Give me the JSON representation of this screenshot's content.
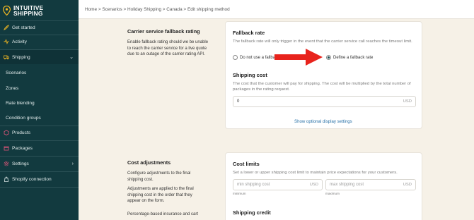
{
  "brand": {
    "line1": "INTUITIVE",
    "line2": "SHIPPING",
    "accent": "#f2b822",
    "sidebar_bg": "#123a3f"
  },
  "sidebar": {
    "items": [
      {
        "label": "Get started",
        "icon": "rocket-icon"
      },
      {
        "label": "Activity",
        "icon": "activity-icon"
      },
      {
        "label": "Shipping",
        "icon": "truck-icon"
      },
      {
        "label": "Scenarios"
      },
      {
        "label": "Zones"
      },
      {
        "label": "Rate blending"
      },
      {
        "label": "Condition groups"
      },
      {
        "label": "Products",
        "icon": "box-icon"
      },
      {
        "label": "Packages",
        "icon": "package-icon"
      },
      {
        "label": "Settings",
        "icon": "gear-icon"
      },
      {
        "label": "Shopify connection",
        "icon": "shopify-icon"
      }
    ]
  },
  "breadcrumb": "Home > Scenarios > Holiday Shipping > Canada > Edit shipping method",
  "fallback_section": {
    "title": "Carrier service fallback rating",
    "description": "Enable fallback rating should we be unable to reach the carrier service for a live quote due to an outage of the carrier rating API."
  },
  "fallback_card": {
    "title": "Fallback rate",
    "description": "The fallback rate will only trigger in the event that the carrier service call reaches the timeout limit.",
    "option_off": "Do not use a fallba",
    "option_on": "Define a fallback rate",
    "selected": "Define a fallback rate",
    "shipping_cost_title": "Shipping cost",
    "shipping_cost_desc": "The cost that the customer will pay for shipping. The cost will be multiplied by the total number of packages in the rating request.",
    "shipping_cost_value": "0",
    "currency": "USD",
    "optional_link": "Show optional display settings"
  },
  "cost_section": {
    "title": "Cost adjustments",
    "p1": "Configure adjustments to the final shipping cost.",
    "p2": "Adjustments are applied to the final shipping cost in the order that they appear on the form.",
    "p3": "Percentage-based insurance and cart"
  },
  "cost_limits_card": {
    "title": "Cost limits",
    "description": "Set a lower or upper shipping cost limit to maintain price expectations for your customers.",
    "min_placeholder": "min shipping cost",
    "max_placeholder": "max shipping cost",
    "min_caption": "minimum",
    "max_caption": "maximum",
    "currency": "USD",
    "shipping_credit_title": "Shipping credit"
  },
  "annotation_arrow_color": "#e8231c"
}
